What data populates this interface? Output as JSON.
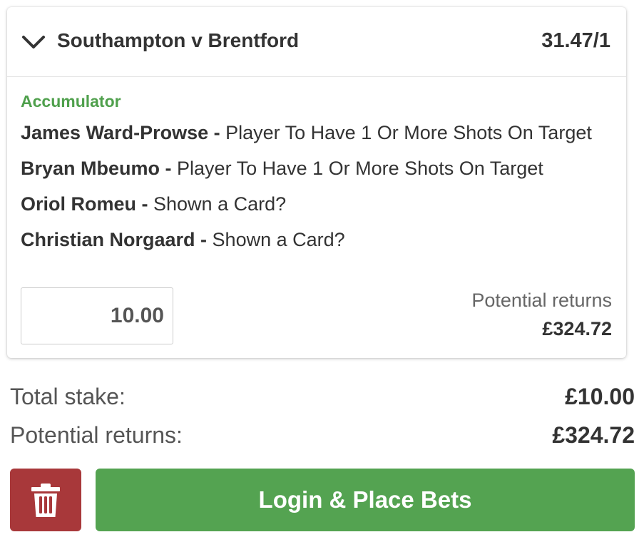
{
  "bet_card": {
    "event_title": "Southampton v Brentford",
    "odds": "31.47/1",
    "bet_type": "Accumulator",
    "selections": [
      {
        "player": "James Ward-Prowse",
        "separator": " - ",
        "market": "Player To Have 1 Or More Shots On Target"
      },
      {
        "player": "Bryan Mbeumo",
        "separator": " - ",
        "market": "Player To Have 1 Or More Shots On Target"
      },
      {
        "player": "Oriol Romeu",
        "separator": " - ",
        "market": "Shown a Card?"
      },
      {
        "player": "Christian Norgaard",
        "separator": " - ",
        "market": "Shown a Card?"
      }
    ],
    "stake_value": "10.00",
    "potential_returns_label": "Potential returns",
    "potential_returns_value": "£324.72"
  },
  "summary": {
    "total_stake_label": "Total stake:",
    "total_stake_value": "£10.00",
    "potential_returns_label": "Potential returns:",
    "potential_returns_value": "£324.72"
  },
  "actions": {
    "delete_icon": "trash-icon",
    "place_bets_label": "Login & Place Bets"
  },
  "colors": {
    "accent_green": "#54a351",
    "bet_type_green": "#4fa04c",
    "delete_red": "#a8383a",
    "text_dark": "#333333"
  }
}
